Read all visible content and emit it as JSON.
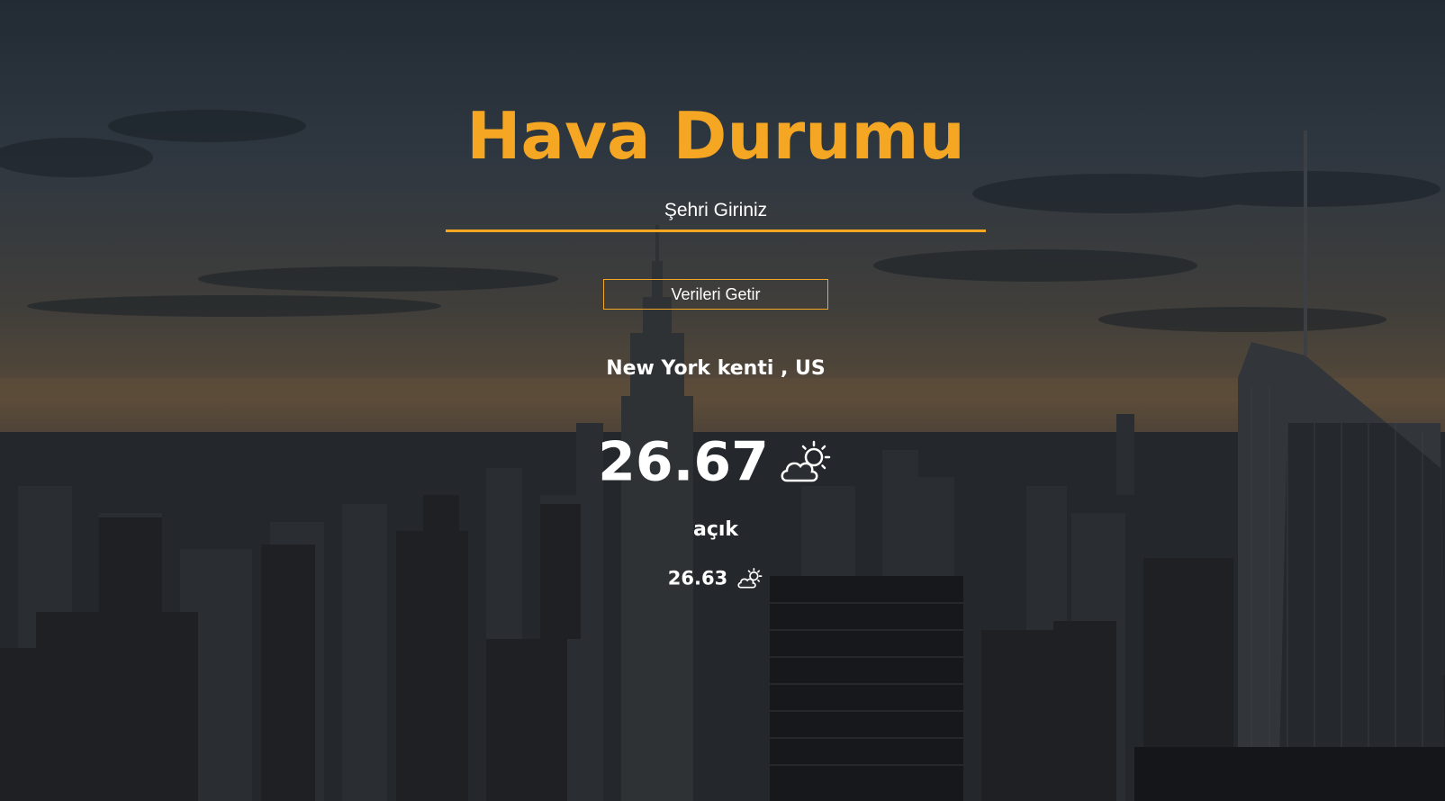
{
  "app": {
    "title": "Hava Durumu",
    "accent_color": "#f5a623",
    "text_color": "#ffffff"
  },
  "search": {
    "placeholder": "Şehri Giriniz",
    "value": ""
  },
  "fetch_button": {
    "label": "Verileri Getir"
  },
  "weather": {
    "location": "New York kenti , US",
    "temperature": "26.67",
    "description": "açık",
    "feels_like": "26.63",
    "icon": "partly-cloudy-sun-icon"
  },
  "background": {
    "scene": "city-skyline-dusk"
  }
}
